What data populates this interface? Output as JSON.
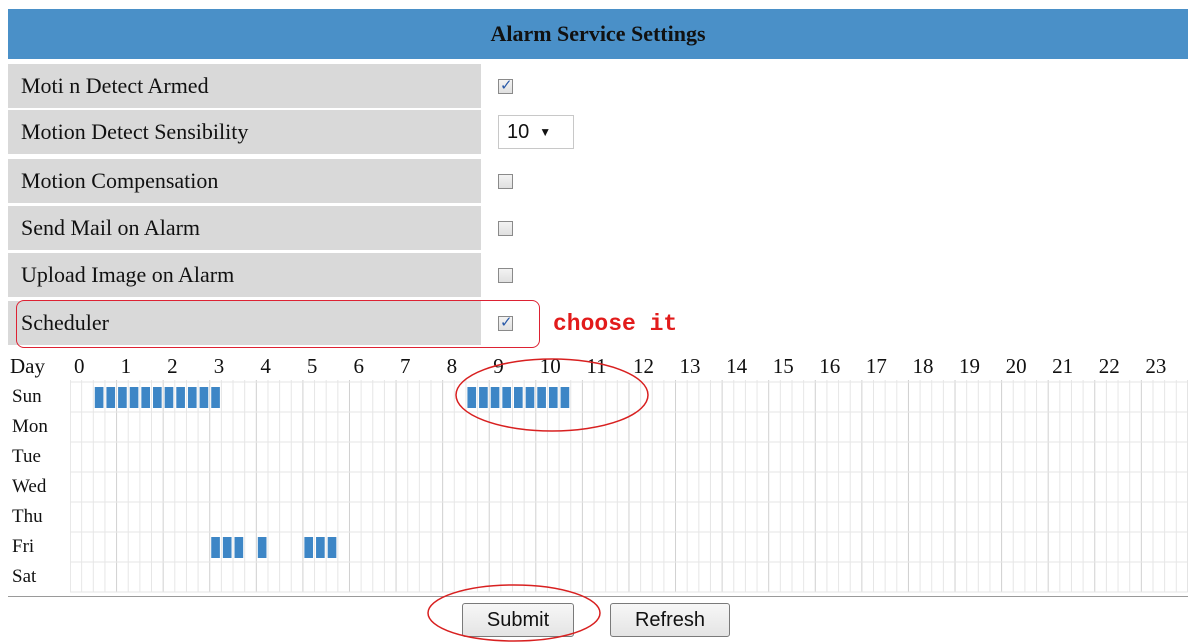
{
  "title": "Alarm Service Settings",
  "settings": [
    {
      "label": "Moti n Detect Armed",
      "control": "checkbox",
      "checked": true
    },
    {
      "label": "Motion Detect Sensibility",
      "control": "select",
      "value": "10"
    },
    {
      "label": "Motion Compensation",
      "control": "checkbox",
      "checked": false
    },
    {
      "label": "Send Mail on Alarm",
      "control": "checkbox",
      "checked": false
    },
    {
      "label": "Upload Image on Alarm",
      "control": "checkbox",
      "checked": false
    },
    {
      "label": "Scheduler",
      "control": "checkbox",
      "checked": true
    }
  ],
  "annotation": "choose it",
  "schedule": {
    "day_header": "Day",
    "hours": [
      "0",
      "1",
      "2",
      "3",
      "4",
      "5",
      "6",
      "7",
      "8",
      "9",
      "10",
      "11",
      "12",
      "13",
      "14",
      "15",
      "16",
      "17",
      "18",
      "19",
      "20",
      "21",
      "22",
      "23"
    ],
    "days": [
      "Sun",
      "Mon",
      "Tue",
      "Wed",
      "Thu",
      "Fri",
      "Sat"
    ],
    "selected_hours": {
      "Sun": [
        [
          0.5,
          3.25
        ],
        [
          8.5,
          10.75
        ]
      ],
      "Fri": [
        [
          3.0,
          3.75
        ],
        [
          4.0,
          4.25
        ],
        [
          5.0,
          5.75
        ]
      ]
    }
  },
  "buttons": {
    "submit": "Submit",
    "refresh": "Refresh"
  },
  "colors": {
    "header": "#4a90c8",
    "label_bg": "#d9d9d9",
    "selected": "#3d86c6",
    "annotation": "#e21b1b"
  }
}
